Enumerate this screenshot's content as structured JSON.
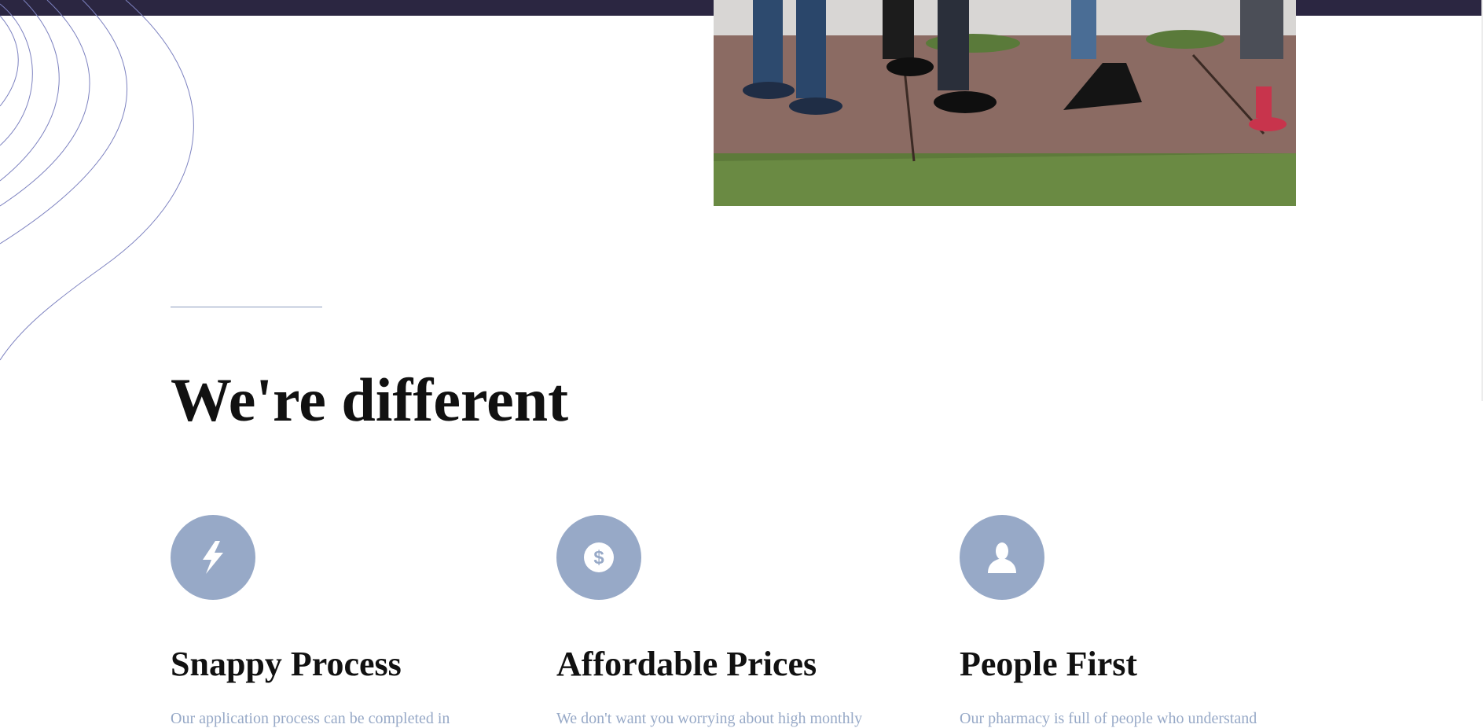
{
  "section": {
    "title": "We're different"
  },
  "features": [
    {
      "icon": "lightning-bolt-icon",
      "title": "Snappy Process",
      "text": "Our application process can be completed in"
    },
    {
      "icon": "dollar-coin-icon",
      "title": "Affordable Prices",
      "text": "We don't want you worrying about high monthly"
    },
    {
      "icon": "person-icon",
      "title": "People First",
      "text": "Our pharmacy is full of people who understand"
    }
  ],
  "colors": {
    "topbar": "#2b2641",
    "icon_circle": "#97a9c7",
    "heading": "#111111",
    "accent_line": "#8a9bbd",
    "waves": "#7d82c0"
  }
}
